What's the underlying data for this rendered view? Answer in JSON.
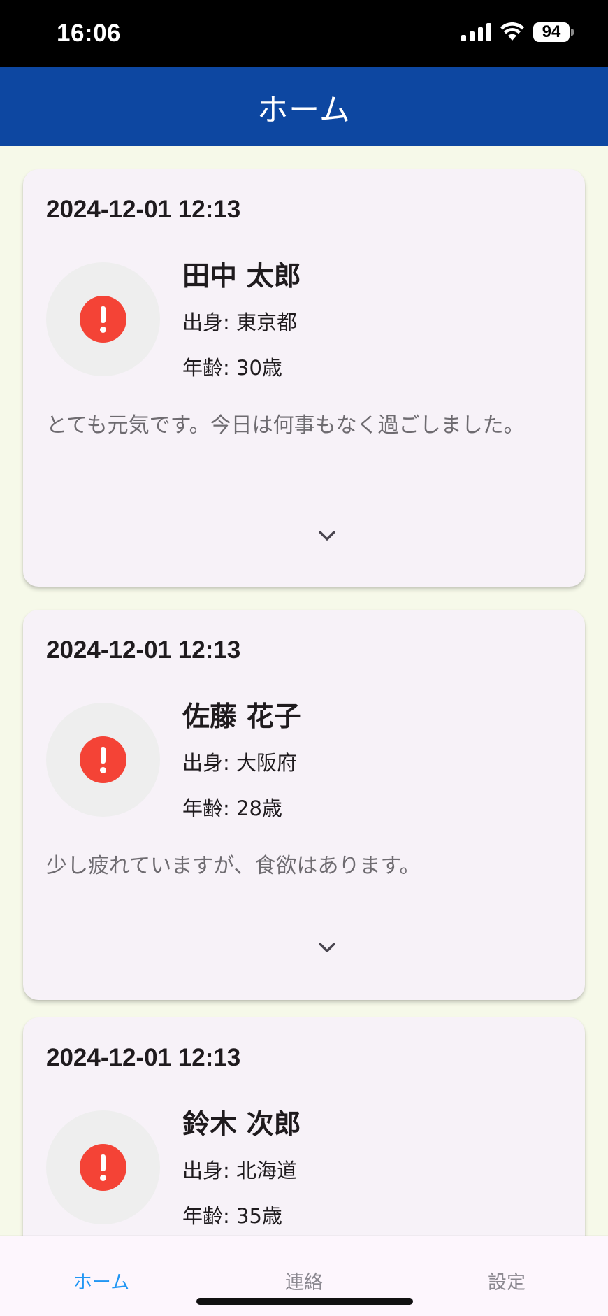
{
  "status_bar": {
    "time": "16:06",
    "battery": "94",
    "icons": [
      "signal-icon",
      "wifi-icon",
      "battery-icon"
    ]
  },
  "header": {
    "title": "ホーム"
  },
  "colors": {
    "header": "#0d47a1",
    "background": "#f6f9e9",
    "card": "#f7f2f8",
    "alert": "#f44336",
    "nav_active": "#2196f3"
  },
  "cards": [
    {
      "date": "2024-12-01 12:13",
      "name": "田中 太郎",
      "origin": "出身: 東京都",
      "age": "年齢: 30歳",
      "note": "とても元気です。今日は何事もなく過ごしました。",
      "status_icon": "alert-icon"
    },
    {
      "date": "2024-12-01 12:13",
      "name": "佐藤 花子",
      "origin": "出身: 大阪府",
      "age": "年齢: 28歳",
      "note": "少し疲れていますが、食欲はあります。",
      "status_icon": "alert-icon"
    },
    {
      "date": "2024-12-01 12:13",
      "name": "鈴木 次郎",
      "origin": "出身: 北海道",
      "age": "年齢: 35歳",
      "status_icon": "alert-icon"
    }
  ],
  "bottom_nav": {
    "items": [
      {
        "label": "ホーム",
        "active": true
      },
      {
        "label": "連絡",
        "active": false
      },
      {
        "label": "設定",
        "active": false
      }
    ]
  }
}
